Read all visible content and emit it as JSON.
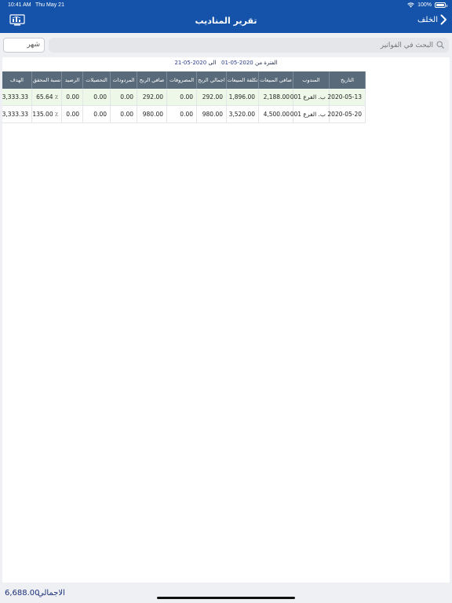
{
  "status_bar": {
    "time": "10:41 AM",
    "date": "Thu May 21",
    "battery": "100%",
    "battery_level": 1.0
  },
  "nav": {
    "title": "تقرير المناديب",
    "back_label": "الخلف",
    "icon": "report-screen-icon",
    "color": "#1453a9"
  },
  "search": {
    "placeholder": "البحث في الفواتير",
    "month_value": "شهر"
  },
  "period": {
    "from_label": "الفترة من",
    "from_date": "2020-05-01",
    "to_label": "الى",
    "to_date": "2020-05-21"
  },
  "table": {
    "headers": {
      "date": "التاريخ",
      "rep": "المندوب",
      "net_sales": "صافي المبيعات",
      "sales_cost": "تكلفة المبيعات",
      "total_profit": "اجمالي الربح",
      "expenses": "المصروفات",
      "net_profit": "صافي الربح",
      "returns": "المردودات",
      "collections": "التحصيلات",
      "balance": "الرصيد",
      "achieved_pct": "نسبة المحقق",
      "target": "الهدف"
    },
    "rows": [
      {
        "date": "2020-05-13",
        "rep": "001 ب. الفرع",
        "net_sales": "2,188.00",
        "sales_cost": "1,896.00",
        "total_profit": "292.00",
        "expenses": "0.00",
        "net_profit": "292.00",
        "returns": "0.00",
        "collections": "0.00",
        "balance": "0.00",
        "achieved_pct": "65.64 ٪",
        "target": "3,333.33"
      },
      {
        "date": "2020-05-20",
        "rep": "001 ب. الفرع",
        "net_sales": "4,500.00",
        "sales_cost": "3,520.00",
        "total_profit": "980.00",
        "expenses": "0.00",
        "net_profit": "980.00",
        "returns": "0.00",
        "collections": "0.00",
        "balance": "0.00",
        "achieved_pct": "135.00 ٪",
        "target": "3,333.33"
      }
    ]
  },
  "footer": {
    "total_label": "الاجمالي",
    "total_value": "6,688.00"
  },
  "colors": {
    "header_bg": "#596b7a",
    "row_highlight": "#eef8e9",
    "total_text": "#1b2f7a"
  }
}
